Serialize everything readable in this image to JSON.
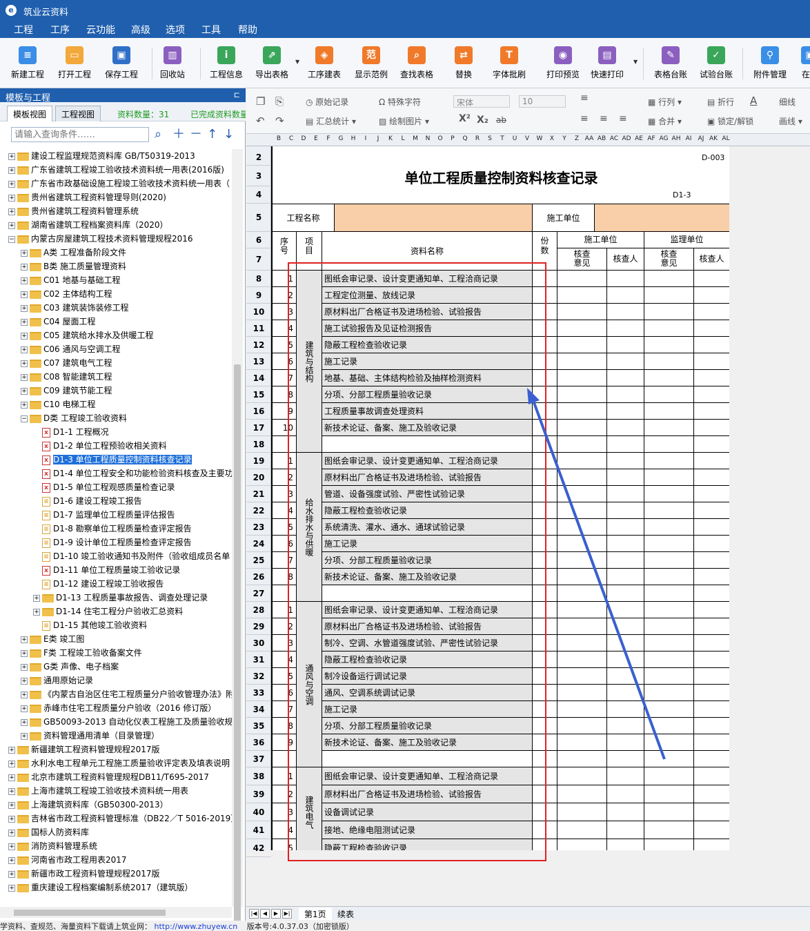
{
  "app": {
    "title": "筑业云资料",
    "logo": "e"
  },
  "menu": [
    "工程",
    "工序",
    "云功能",
    "高级",
    "选项",
    "工具",
    "帮助"
  ],
  "toolbar": [
    {
      "label": "新建工程",
      "icon": "new-doc-icon",
      "color": "#3a8ee6",
      "glyph": "≡"
    },
    {
      "label": "打开工程",
      "icon": "open-folder-icon",
      "color": "#f2a83b",
      "glyph": "▭"
    },
    {
      "label": "保存工程",
      "icon": "save-icon",
      "color": "#2f6fc7",
      "glyph": "▣"
    },
    {
      "label": "回收站",
      "icon": "trash-icon",
      "color": "#8b5fbf",
      "glyph": "▥"
    },
    {
      "label": "工程信息",
      "icon": "info-icon",
      "color": "#3aa65a",
      "glyph": "i"
    },
    {
      "label": "导出表格",
      "icon": "export-icon",
      "color": "#3aa65a",
      "glyph": "⇗"
    },
    {
      "label": "工序建表",
      "icon": "layers-icon",
      "color": "#f07a2a",
      "glyph": "◈"
    },
    {
      "label": "显示范例",
      "icon": "example-icon",
      "color": "#f07a2a",
      "glyph": "范"
    },
    {
      "label": "查找表格",
      "icon": "search-icon",
      "color": "#f07a2a",
      "glyph": "⌕"
    },
    {
      "label": "替换",
      "icon": "replace-icon",
      "color": "#f07a2a",
      "glyph": "⇄"
    },
    {
      "label": "字体批刷",
      "icon": "font-brush-icon",
      "color": "#f07a2a",
      "glyph": "T"
    },
    {
      "label": "打印预览",
      "icon": "print-preview-icon",
      "color": "#8b5fbf",
      "glyph": "◉"
    },
    {
      "label": "快速打印",
      "icon": "print-icon",
      "color": "#8b5fbf",
      "glyph": "▤"
    },
    {
      "label": "表格台账",
      "icon": "ledger-icon",
      "color": "#8b5fbf",
      "glyph": "✎"
    },
    {
      "label": "试验台账",
      "icon": "test-ledger-icon",
      "color": "#3aa65a",
      "glyph": "✓"
    },
    {
      "label": "附件管理",
      "icon": "attachment-icon",
      "color": "#3a8ee6",
      "glyph": "⚲"
    },
    {
      "label": "在线",
      "icon": "online-icon",
      "color": "#3a8ee6",
      "glyph": "▣"
    }
  ],
  "leftpanel": {
    "title": "模板与工程",
    "tab1": "模板视图",
    "tab2": "工程视图",
    "count": "资料数量：31",
    "done": "已完成资料数量",
    "search_placeholder": "请输入查询条件……",
    "tree": [
      {
        "label": "建设工程监理规范资料库 GB/T50319-2013",
        "lvl": 0,
        "t": "f"
      },
      {
        "label": "广东省建筑工程竣工验收技术资料统一用表(2016版)",
        "lvl": 0,
        "t": "f"
      },
      {
        "label": "广东省市政基础设施工程竣工验收技术资料统一用表（",
        "lvl": 0,
        "t": "f"
      },
      {
        "label": "贵州省建筑工程资料管理导则(2020)",
        "lvl": 0,
        "t": "f"
      },
      {
        "label": "贵州省建筑工程资料管理系统",
        "lvl": 0,
        "t": "f"
      },
      {
        "label": "湖南省建筑工程档案资料库（2020）",
        "lvl": 0,
        "t": "f"
      },
      {
        "label": "内蒙古房屋建筑工程技术资料管理规程2016",
        "lvl": 0,
        "t": "fo"
      },
      {
        "label": "A类 工程准备阶段文件",
        "lvl": 1,
        "t": "f"
      },
      {
        "label": "B类 施工质量管理资料",
        "lvl": 1,
        "t": "f"
      },
      {
        "label": "C01 地基与基础工程",
        "lvl": 1,
        "t": "f"
      },
      {
        "label": "C02 主体结构工程",
        "lvl": 1,
        "t": "f"
      },
      {
        "label": "C03 建筑装饰装修工程",
        "lvl": 1,
        "t": "f"
      },
      {
        "label": "C04 屋面工程",
        "lvl": 1,
        "t": "f"
      },
      {
        "label": "C05 建筑给水排水及供暖工程",
        "lvl": 1,
        "t": "f"
      },
      {
        "label": "C06 通风与空调工程",
        "lvl": 1,
        "t": "f"
      },
      {
        "label": "C07 建筑电气工程",
        "lvl": 1,
        "t": "f"
      },
      {
        "label": "C08 智能建筑工程",
        "lvl": 1,
        "t": "f"
      },
      {
        "label": "C09 建筑节能工程",
        "lvl": 1,
        "t": "f"
      },
      {
        "label": "C10 电梯工程",
        "lvl": 1,
        "t": "f"
      },
      {
        "label": "D类 工程竣工验收资料",
        "lvl": 1,
        "t": "fo"
      },
      {
        "label": "D1-1 工程概况",
        "lvl": 2,
        "t": "r"
      },
      {
        "label": "D1-2 单位工程预验收相关资料",
        "lvl": 2,
        "t": "r"
      },
      {
        "label": "D1-3 单位工程质量控制资料核查记录",
        "lvl": 2,
        "t": "r",
        "sel": true
      },
      {
        "label": "D1-4 单位工程安全和功能检验资料核查及主要功",
        "lvl": 2,
        "t": "r"
      },
      {
        "label": "D1-5 单位工程观感质量检查记录",
        "lvl": 2,
        "t": "r"
      },
      {
        "label": "D1-6 建设工程竣工报告",
        "lvl": 2,
        "t": "y"
      },
      {
        "label": "D1-7 监理单位工程质量评估报告",
        "lvl": 2,
        "t": "y"
      },
      {
        "label": "D1-8 勘察单位工程质量检查评定报告",
        "lvl": 2,
        "t": "y"
      },
      {
        "label": "D1-9 设计单位工程质量检查评定报告",
        "lvl": 2,
        "t": "y"
      },
      {
        "label": "D1-10 竣工验收通知书及附件（验收组成员名单",
        "lvl": 2,
        "t": "y"
      },
      {
        "label": "D1-11 单位工程质量竣工验收记录",
        "lvl": 2,
        "t": "r"
      },
      {
        "label": "D1-12 建设工程竣工验收报告",
        "lvl": 2,
        "t": "y"
      },
      {
        "label": "D1-13 工程质量事故报告、调查处理记录",
        "lvl": 2,
        "t": "f"
      },
      {
        "label": "D1-14 住宅工程分户验收汇总资料",
        "lvl": 2,
        "t": "f"
      },
      {
        "label": "D1-15 其他竣工验收资料",
        "lvl": 2,
        "t": "y"
      },
      {
        "label": "E类 竣工图",
        "lvl": 1,
        "t": "f"
      },
      {
        "label": "F类 工程竣工验收备案文件",
        "lvl": 1,
        "t": "f"
      },
      {
        "label": "G类 声像、电子档案",
        "lvl": 1,
        "t": "f"
      },
      {
        "label": "通用原始记录",
        "lvl": 1,
        "t": "f"
      },
      {
        "label": "《内蒙古自治区住宅工程质量分户验收管理办法》附",
        "lvl": 1,
        "t": "f"
      },
      {
        "label": "赤峰市住宅工程质量分户验收（2016 修订版）",
        "lvl": 1,
        "t": "f"
      },
      {
        "label": "GB50093-2013 自动化仪表工程施工及质量验收规范",
        "lvl": 1,
        "t": "f"
      },
      {
        "label": "资料管理通用清单（目录管理）",
        "lvl": 1,
        "t": "f"
      },
      {
        "label": "新疆建筑工程资料管理规程2017版",
        "lvl": 0,
        "t": "f"
      },
      {
        "label": "水利水电工程单元工程施工质量验收评定表及填表说明",
        "lvl": 0,
        "t": "f"
      },
      {
        "label": "北京市建筑工程资料管理规程DB11/T695-2017",
        "lvl": 0,
        "t": "f"
      },
      {
        "label": "上海市建筑工程竣工验收技术资料统一用表",
        "lvl": 0,
        "t": "f"
      },
      {
        "label": "上海建筑资料库（GB50300-2013）",
        "lvl": 0,
        "t": "f"
      },
      {
        "label": "吉林省市政工程资料管理标准（DB22／T 5016-2019）",
        "lvl": 0,
        "t": "f"
      },
      {
        "label": "国标人防资料库",
        "lvl": 0,
        "t": "f"
      },
      {
        "label": "消防资料管理系统",
        "lvl": 0,
        "t": "f"
      },
      {
        "label": "河南省市政工程用表2017",
        "lvl": 0,
        "t": "f"
      },
      {
        "label": "新疆市政工程资料管理规程2017版",
        "lvl": 0,
        "t": "f"
      },
      {
        "label": "重庆建设工程档案编制系统2017（建筑版）",
        "lvl": 0,
        "t": "f"
      }
    ]
  },
  "format": {
    "original": "原始记录",
    "summary": "汇总统计",
    "special": "特殊字符",
    "drawpic": "绘制图片",
    "font": "宋体",
    "size": "10",
    "row": "行列",
    "merge": "合并",
    "wrap": "折行",
    "lock": "锁定/解锁",
    "border": "细线",
    "line": "画线"
  },
  "columns": [
    "B",
    "C",
    "D",
    "E",
    "F",
    "G",
    "H",
    "I",
    "J",
    "K",
    "L",
    "M",
    "N",
    "O",
    "P",
    "Q",
    "R",
    "S",
    "T",
    "U",
    "V",
    "W",
    "X",
    "Y",
    "Z",
    "AA",
    "AB",
    "AC",
    "AD",
    "AE",
    "AF",
    "AG",
    "AH",
    "AI",
    "AJ",
    "AK",
    "AL"
  ],
  "sheet": {
    "code": "D-003",
    "title": "单位工程质量控制资料核查记录",
    "subcode": "D1-3",
    "proj_label": "工程名称",
    "cons_label": "施工单位",
    "h_seq": "序号",
    "h_item": "项目",
    "h_name": "资料名称",
    "h_copies": "份数",
    "h_cons": "施工单位",
    "h_sup": "监理单位",
    "h_opinion": "核查意见",
    "h_checker": "核查人",
    "groups": [
      {
        "name": "建筑与结构",
        "rows": [
          "图纸会审记录、设计变更通知单、工程洽商记录",
          "工程定位测量、放线记录",
          "原材料出厂合格证书及进场检验、试验报告",
          "施工试验报告及见证检测报告",
          "隐蔽工程检查验收记录",
          "施工记录",
          "地基、基础、主体结构检验及抽样检测资料",
          "分项、分部工程质量验收记录",
          "工程质量事故调查处理资料",
          "新技术论证、备案、施工及验收记录"
        ]
      },
      {
        "name": "给水排水与供暖",
        "rows": [
          "图纸会审记录、设计变更通知单、工程洽商记录",
          "原材料出厂合格证书及进场检验、试验报告",
          "管道、设备强度试验、严密性试验记录",
          "隐蔽工程检查验收记录",
          "系统清洗、灌水、通水、通球试验记录",
          "施工记录",
          "分项、分部工程质量验收记录",
          "新技术论证、备案、施工及验收记录"
        ]
      },
      {
        "name": "通风与空调",
        "rows": [
          "图纸会审记录、设计变更通知单、工程洽商记录",
          "原材料出厂合格证书及进场检验、试验报告",
          "制冷、空调、水管道强度试验、严密性试验记录",
          "隐蔽工程检查验收记录",
          "制冷设备运行调试记录",
          "通风、空调系统调试记录",
          "施工记录",
          "分项、分部工程质量验收记录",
          "新技术论证、备案、施工及验收记录"
        ]
      },
      {
        "name": "建筑电气",
        "rows": [
          "图纸会审记录、设计变更通知单、工程洽商记录",
          "原材料出厂合格证书及进场检验、试验报告",
          "设备调试记录",
          "接地、绝缘电阻测试记录",
          "隐蔽工程检查验收记录"
        ]
      }
    ]
  },
  "sheettabs": [
    "第1页",
    "续表"
  ],
  "status": {
    "text": "学资料、查规范、海量资料下载请上筑业网：",
    "url": "http://www.zhuyew.cn",
    "version": "版本号:4.0.37.03（加密锁版）"
  }
}
